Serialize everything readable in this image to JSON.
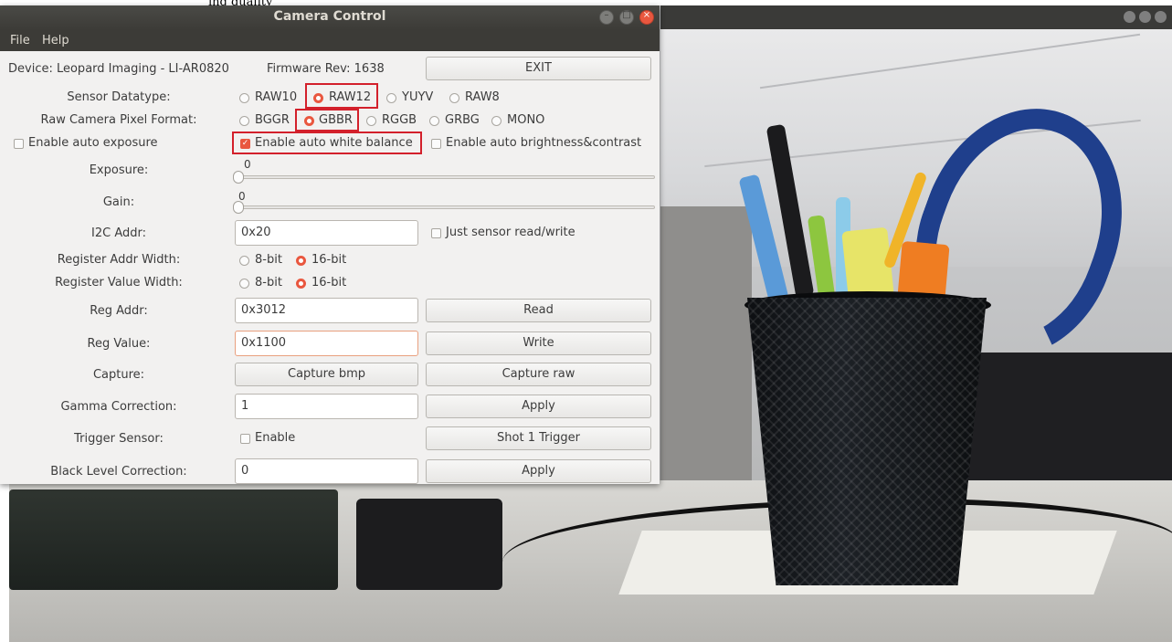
{
  "top_caption": "ing quality",
  "window": {
    "title": "Camera Control",
    "buttons": {
      "minimize": "–",
      "maximize": "□",
      "close": "×"
    }
  },
  "menu": {
    "file": "File",
    "help": "Help"
  },
  "device": {
    "label": "Device: Leopard Imaging - LI-AR0820",
    "firmware": "Firmware Rev: 1638",
    "exit_button": "EXIT"
  },
  "sensor_datatype": {
    "label": "Sensor Datatype:",
    "options": [
      "RAW10",
      "RAW12",
      "YUYV",
      "RAW8"
    ],
    "selected": "RAW12"
  },
  "pixel_format": {
    "label": "Raw Camera Pixel Format:",
    "options": [
      "BGGR",
      "GBBR",
      "RGGB",
      "GRBG",
      "MONO"
    ],
    "selected": "GBBR"
  },
  "checkboxes": {
    "auto_exposure": {
      "label": "Enable auto exposure",
      "checked": false
    },
    "auto_white_balance": {
      "label": "Enable auto white balance",
      "checked": true
    },
    "auto_brightness": {
      "label": "Enable auto brightness&contrast",
      "checked": false
    }
  },
  "exposure": {
    "label": "Exposure:",
    "value": "0"
  },
  "gain": {
    "label": "Gain:",
    "value": "0"
  },
  "i2c": {
    "label": "I2C Addr:",
    "value": "0x20",
    "just_sensor": "Just sensor read/write"
  },
  "reg_addr_width": {
    "label": "Register Addr Width:",
    "options": [
      "8-bit",
      "16-bit"
    ],
    "selected": "16-bit"
  },
  "reg_value_width": {
    "label": "Register Value Width:",
    "options": [
      "8-bit",
      "16-bit"
    ],
    "selected": "16-bit"
  },
  "reg_addr": {
    "label": "Reg Addr:",
    "value": "0x3012",
    "button": "Read"
  },
  "reg_value": {
    "label": "Reg Value:",
    "value": "0x1100",
    "button": "Write"
  },
  "capture": {
    "label": "Capture:",
    "bmp_button": "Capture bmp",
    "raw_button": "Capture raw"
  },
  "gamma": {
    "label": "Gamma Correction:",
    "value": "1",
    "button": "Apply"
  },
  "trigger": {
    "label": "Trigger Sensor:",
    "enable": "Enable",
    "button": "Shot 1 Trigger"
  },
  "black_level": {
    "label": "Black Level Correction:",
    "value": "0",
    "button": "Apply"
  },
  "colors": {
    "accent": "#e9573f",
    "highlight": "#d3202b",
    "titlebar": "#3c3b37"
  }
}
